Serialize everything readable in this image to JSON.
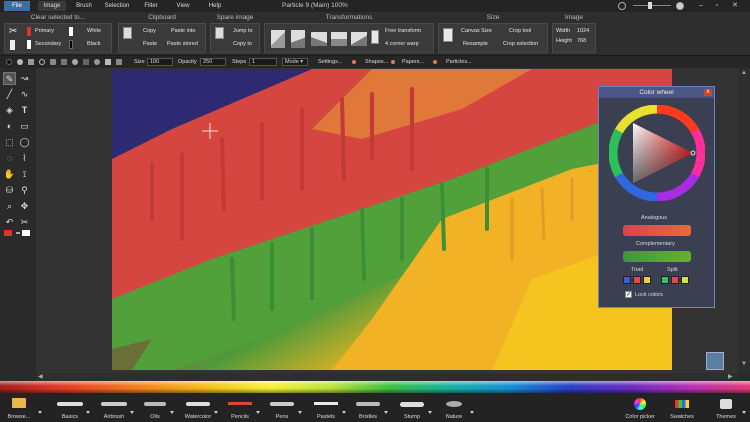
{
  "app": {
    "title": "Particle 9 (Main)  100%",
    "menu": [
      "File",
      "Image",
      "Brush",
      "Selection",
      "Filter",
      "View",
      "Help"
    ],
    "active_menu": "Image"
  },
  "ribbon": {
    "groups": {
      "clear_selected": "Clear selected to...",
      "clipboard": "Clipboard",
      "spare_image": "Spare image",
      "transformations": "Transformations",
      "size": "Size",
      "image": "Image"
    },
    "clear": {
      "primary": "Primary",
      "secondary": "Secondary",
      "white": "White",
      "black": "Black"
    },
    "clipboard": {
      "copy": "Copy",
      "paste": "Paste",
      "paste_into": "Paste into",
      "paste_stored": "Paste stored"
    },
    "spare": {
      "jump_to": "Jump to",
      "copy_to": "Copy to"
    },
    "transform": {
      "free_transform": "Free transform",
      "corner_warp": "4 corner warp"
    },
    "size": {
      "canvas_size": "Canvas Size",
      "resample": "Resample",
      "crop_tool": "Crop tool",
      "crop_selection": "Crop selection"
    },
    "image": {
      "width_label": "Width",
      "width": "1024",
      "height_label": "Height",
      "height": "768"
    }
  },
  "tool_options": {
    "size_label": "Size",
    "size": "100",
    "opacity_label": "Opacity",
    "opacity": "250",
    "steps_label": "Steps",
    "steps": "1",
    "mode_label": "Mode",
    "settings": "Settings...",
    "shapes": "Shapes...",
    "papers": "Papers...",
    "particles": "Particles..."
  },
  "color_wheel": {
    "title": "Color wheel",
    "analogous": "Analogous",
    "complementary": "Complementary",
    "triad": "Triad",
    "split": "Split",
    "lock_colors": "Lock colors",
    "lock_checked": true,
    "colors": {
      "analogous": "#e04a48",
      "complementary": "#3aa33a",
      "triad": [
        "#3a5fd8",
        "#e84a4a",
        "#f0d040"
      ],
      "split": [
        "#3ac060",
        "#4a8fe0",
        "#e0e040"
      ]
    }
  },
  "bottom_tools": [
    "Browse...",
    "Basics",
    "Airbrush",
    "Oils",
    "Watercolor",
    "Pencils",
    "Pens",
    "Pastels",
    "Bristles",
    "Stump",
    "Nature",
    "Color picker",
    "Swatches",
    "Themes"
  ],
  "colors": {
    "accent": "#3b6ea5",
    "primary_swatch": "#e03030",
    "secondary_swatch": "#ffffff"
  }
}
